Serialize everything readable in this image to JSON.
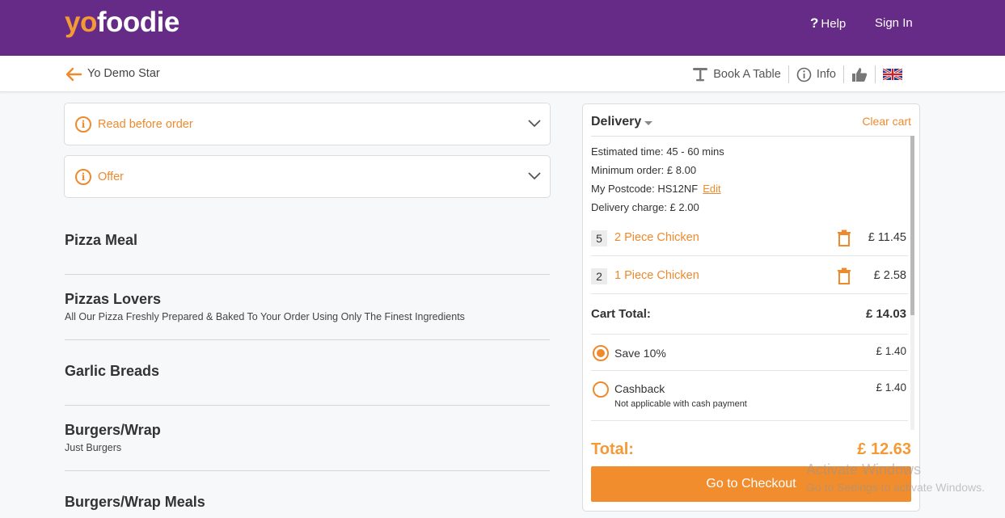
{
  "header": {
    "logo_yo": "yo",
    "logo_foodie": "foodie",
    "help_label": "Help",
    "signin_label": "Sign In",
    "bg_color": "#662b86"
  },
  "subheader": {
    "restaurant_name": "Yo Demo Star",
    "book_table_label": "Book A Table",
    "info_label": "Info"
  },
  "accordions": [
    {
      "label": "Read before order"
    },
    {
      "label": "Offer"
    }
  ],
  "categories": [
    {
      "title": "Pizza Meal",
      "desc": ""
    },
    {
      "title": "Pizzas Lovers",
      "desc": "All Our Pizza Freshly Prepared & Baked To Your Order Using Only The Finest Ingredients"
    },
    {
      "title": "Garlic Breads",
      "desc": ""
    },
    {
      "title": "Burgers/Wrap",
      "desc": "Just Burgers"
    },
    {
      "title": "Burgers/Wrap Meals",
      "desc": ""
    }
  ],
  "cart": {
    "mode": "Delivery",
    "clear_label": "Clear cart",
    "estimated_time": "Estimated time: 45 - 60 mins",
    "minimum_order": "Minimum order: £ 8.00",
    "postcode": "My Postcode: HS12NF",
    "edit_label": "Edit",
    "delivery_charge": "Delivery charge: £ 2.00",
    "items": [
      {
        "qty": "5",
        "name": "2 Piece Chicken",
        "price": "£ 11.45"
      },
      {
        "qty": "2",
        "name": "1 Piece Chicken",
        "price": "£ 2.58"
      }
    ],
    "cart_total_label": "Cart Total:",
    "cart_total_value": "£ 14.03",
    "options": [
      {
        "label": "Save 10%",
        "value": "£ 1.40",
        "selected": true,
        "sub": ""
      },
      {
        "label": "Cashback",
        "value": "£ 1.40",
        "selected": false,
        "sub": "Not applicable with cash payment"
      }
    ],
    "total_label": "Total:",
    "total_value": "£ 12.63",
    "checkout_label": "Go to Checkout",
    "accent_color": "#ee8a2c"
  },
  "watermark": {
    "line1": "Activate Windows",
    "line2": "Go to Settings to activate Windows."
  }
}
